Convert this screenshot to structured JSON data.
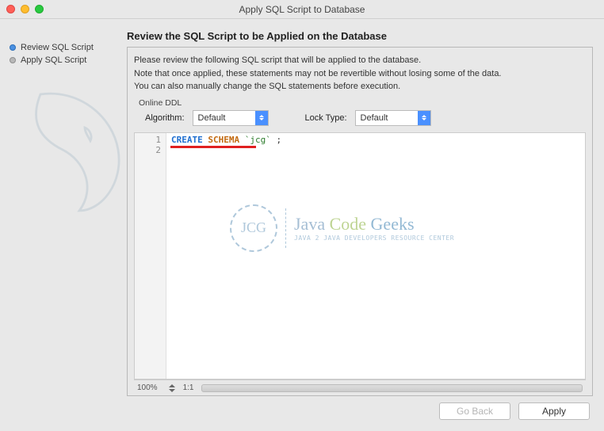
{
  "window": {
    "title": "Apply SQL Script to Database"
  },
  "sidebar": {
    "items": [
      {
        "label": "Review SQL Script",
        "active": true
      },
      {
        "label": "Apply SQL Script",
        "active": false
      }
    ]
  },
  "main": {
    "title": "Review the SQL Script to be Applied on the Database",
    "desc1": "Please review the following SQL script that will be applied to the database.",
    "desc2": "Note that once applied, these statements may not be revertible without losing some of the data.",
    "desc3": "You can also manually change the SQL statements before execution.",
    "ddl_caption": "Online DDL",
    "algo_label": "Algorithm:",
    "algo_value": "Default",
    "lock_label": "Lock Type:",
    "lock_value": "Default"
  },
  "editor": {
    "line_numbers": [
      "1",
      "2"
    ],
    "tokens": {
      "kw1": "CREATE",
      "kw2": "SCHEMA",
      "str": "`jcg`",
      "term": ";"
    }
  },
  "watermark": {
    "mono": "JCG",
    "text_java": "Java ",
    "text_code": "Code ",
    "text_geeks": "Geeks",
    "sub": "Java 2 Java Developers Resource Center"
  },
  "status": {
    "zoom": "100%",
    "pos": "1:1"
  },
  "footer": {
    "back": "Go Back",
    "apply": "Apply"
  }
}
